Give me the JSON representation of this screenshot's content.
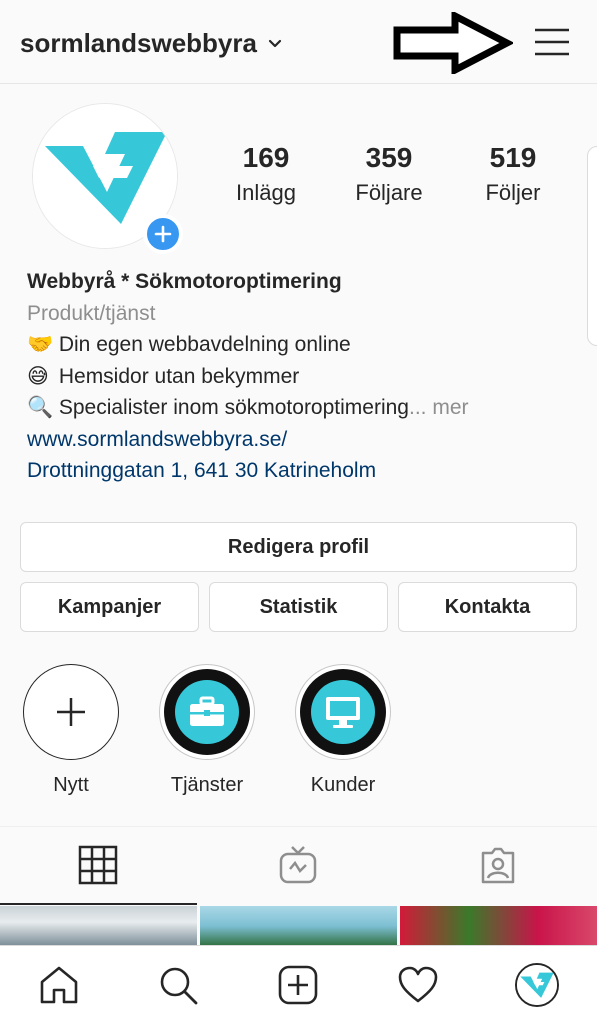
{
  "header": {
    "username": "sormlandswebbyra",
    "username_icon": "chevron-down-icon",
    "arrow_icon": "right-arrow-icon",
    "menu_icon": "hamburger-menu-icon"
  },
  "profile": {
    "avatar_icon": "webbyra-logo",
    "add_story_icon": "plus-icon",
    "stats": [
      {
        "value": "169",
        "label": "Inlägg"
      },
      {
        "value": "359",
        "label": "Följare"
      },
      {
        "value": "519",
        "label": "Följer"
      }
    ]
  },
  "bio": {
    "name": "Webbyrå * Sökmotoroptimering",
    "category": "Produkt/tjänst",
    "lines": [
      {
        "emoji": "🤝",
        "text": "Din egen webbavdelning online"
      },
      {
        "emoji": "😅",
        "text": "Hemsidor utan bekymmer"
      },
      {
        "emoji": "🔍",
        "text": "Specialister inom sökmotoroptimering"
      }
    ],
    "more_text": "... mer",
    "website": "www.sormlandswebbyra.se/",
    "address": "Drottninggatan 1, 641 30 Katrineholm"
  },
  "buttons": {
    "edit_profile": "Redigera profil",
    "campaigns": "Kampanjer",
    "statistics": "Statistik",
    "contact": "Kontakta"
  },
  "highlights": [
    {
      "label": "Nytt",
      "icon": "plus-icon"
    },
    {
      "label": "Tjänster",
      "icon": "briefcase-icon"
    },
    {
      "label": "Kunder",
      "icon": "monitor-icon"
    }
  ],
  "tabs": [
    {
      "icon": "grid-icon",
      "active": true
    },
    {
      "icon": "igtv-icon",
      "active": false
    },
    {
      "icon": "tagged-icon",
      "active": false
    }
  ],
  "bottom_nav": [
    {
      "icon": "home-icon"
    },
    {
      "icon": "search-icon"
    },
    {
      "icon": "add-post-icon"
    },
    {
      "icon": "heart-icon"
    },
    {
      "icon": "profile-avatar"
    }
  ],
  "colors": {
    "accent_blue": "#3897f0",
    "link": "#00376b",
    "secondary_text": "#8e8e8e",
    "logo_cyan": "#36c8d8"
  }
}
